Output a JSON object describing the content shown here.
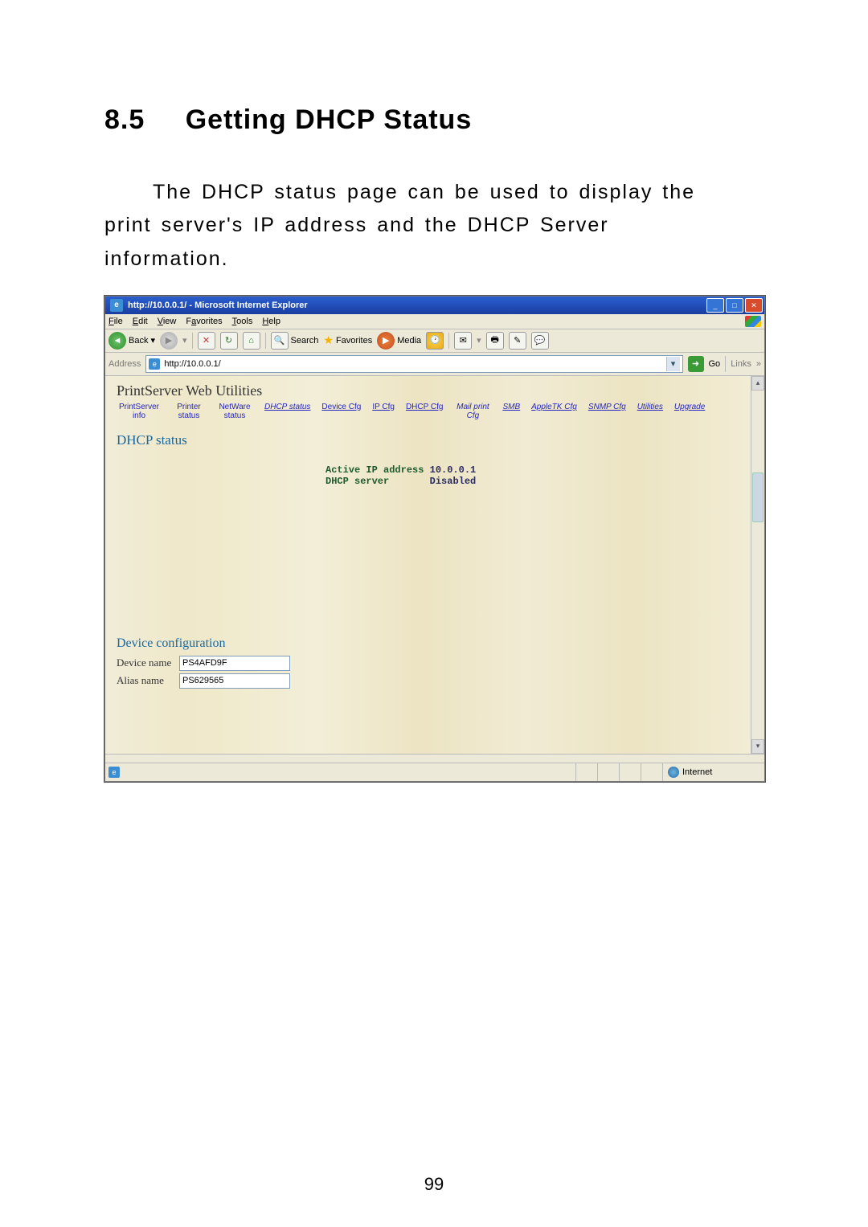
{
  "doc": {
    "section_number": "8.5",
    "section_title": "Getting DHCP Status",
    "paragraph_a": "The DHCP status page can be used to display the",
    "paragraph_b": "print server's IP address and the DHCP Server",
    "paragraph_c": "information.",
    "page_number": "99"
  },
  "window": {
    "title": "http://10.0.0.1/ - Microsoft Internet Explorer",
    "min": "_",
    "max": "□",
    "close": "✕"
  },
  "menu": {
    "file": "File",
    "edit": "Edit",
    "view": "View",
    "favorites": "Favorites",
    "tools": "Tools",
    "help": "Help"
  },
  "toolbar": {
    "back": "Back",
    "forward": "▶",
    "stop": "✕",
    "refresh": "↻",
    "home": "⌂",
    "search": "Search",
    "favorites": "Favorites",
    "media": "Media",
    "history": "🕑",
    "mail": "✉",
    "print": "🖶",
    "edit": "✎",
    "discuss": "💬"
  },
  "address": {
    "label": "Address",
    "value": "http://10.0.0.1/",
    "go": "Go",
    "links": "Links",
    "chevron": "»"
  },
  "page": {
    "utilities_title": "PrintServer  Web  Utilities",
    "nav": {
      "printserver_info": "PrintServer info",
      "printer_status": "Printer status",
      "netware_status": "NetWare status",
      "dhcp_status": "DHCP status",
      "device_cfg": "Device Cfg",
      "ip_cfg": "IP Cfg",
      "dhcp_cfg": "DHCP Cfg",
      "mail_print_cfg": "Mail print Cfg",
      "smb": "SMB",
      "appletk_cfg": "AppleTK Cfg",
      "snmp_cfg": "SNMP Cfg",
      "utilities": "Utilities",
      "upgrade": "Upgrade"
    },
    "dhcp_heading": "DHCP status",
    "line1_label": "Active IP address",
    "line1_value": "10.0.0.1",
    "line2_label": "DHCP server",
    "line2_value": "Disabled",
    "dev_cfg_heading": "Device configuration",
    "device_name_label": "Device name",
    "device_name_value": "PS4AFD9F",
    "alias_name_label": "Alias name",
    "alias_name_value": "PS629565"
  },
  "status": {
    "zone": "Internet"
  }
}
